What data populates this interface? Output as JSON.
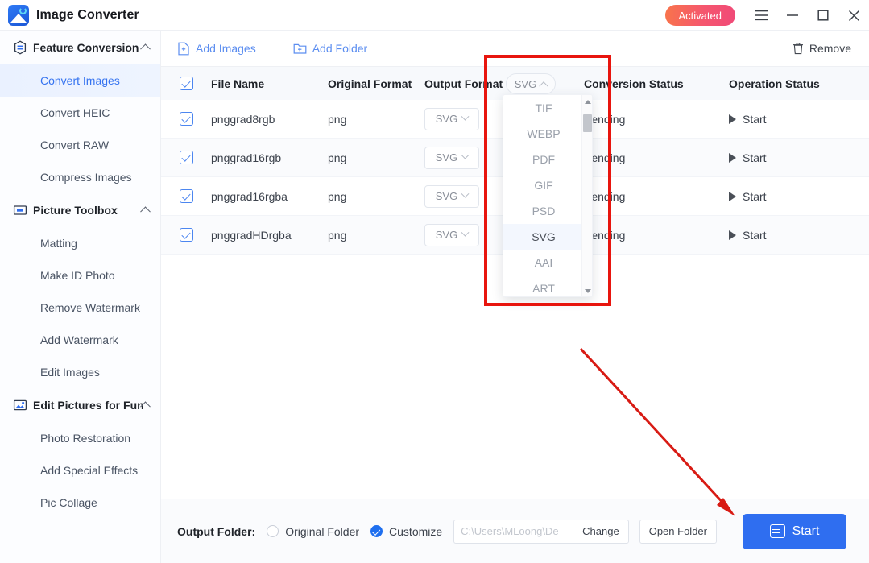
{
  "titlebar": {
    "app_title": "Image Converter",
    "activated_label": "Activated",
    "logo_icon": "image-refresh-logo-icon",
    "menu_icon": "hamburger-menu-icon",
    "minimize_icon": "minimize-icon",
    "maximize_icon": "maximize-icon",
    "close_icon": "close-icon",
    "accent": "#2f6ef0",
    "activated_gradient": [
      "#f8744b",
      "#f04a78"
    ]
  },
  "sidebar": {
    "sections": [
      {
        "label": "Feature Conversion",
        "icon": "conversion-hex-icon",
        "expanded": true,
        "items": [
          {
            "label": "Convert Images",
            "active": true
          },
          {
            "label": "Convert HEIC",
            "active": false
          },
          {
            "label": "Convert RAW",
            "active": false
          },
          {
            "label": "Compress Images",
            "active": false
          }
        ]
      },
      {
        "label": "Picture Toolbox",
        "icon": "toolbox-frame-icon",
        "expanded": true,
        "items": [
          {
            "label": "Matting",
            "active": false
          },
          {
            "label": "Make ID Photo",
            "active": false
          },
          {
            "label": "Remove Watermark",
            "active": false
          },
          {
            "label": "Add Watermark",
            "active": false
          },
          {
            "label": "Edit Images",
            "active": false
          }
        ]
      },
      {
        "label": "Edit Pictures for Fun",
        "icon": "picture-sparkle-icon",
        "expanded": true,
        "items": [
          {
            "label": "Photo Restoration",
            "active": false
          },
          {
            "label": "Add Special Effects",
            "active": false
          },
          {
            "label": "Pic Collage",
            "active": false
          }
        ]
      }
    ]
  },
  "toolbar": {
    "add_images_label": "Add Images",
    "add_folder_label": "Add Folder",
    "remove_label": "Remove",
    "add_images_icon": "file-plus-icon",
    "add_folder_icon": "folder-plus-icon",
    "remove_icon": "trash-icon"
  },
  "table": {
    "headers": {
      "file_name": "File Name",
      "original_format": "Original Format",
      "output_format": "Output Format",
      "conversion_status": "Conversion Status",
      "operation_status": "Operation Status"
    },
    "header_checkbox_checked": true,
    "rows": [
      {
        "checked": true,
        "file_name": "pnggrad8rgb",
        "original_format": "png",
        "output_format": "SVG",
        "conversion_status": "Pending",
        "operation": "Start"
      },
      {
        "checked": true,
        "file_name": "pnggrad16rgb",
        "original_format": "png",
        "output_format": "SVG",
        "conversion_status": "Pending",
        "operation": "Start"
      },
      {
        "checked": true,
        "file_name": "pnggrad16rgba",
        "original_format": "png",
        "output_format": "SVG",
        "conversion_status": "Pending",
        "operation": "Start"
      },
      {
        "checked": true,
        "file_name": "pnggradHDrgba",
        "original_format": "png",
        "output_format": "SVG",
        "conversion_status": "Pending",
        "operation": "Start"
      }
    ]
  },
  "format_dropdown": {
    "selected": "SVG",
    "open": true,
    "toggle_icon": "chevron-up-icon",
    "options": [
      "TIF",
      "WEBP",
      "PDF",
      "GIF",
      "PSD",
      "SVG",
      "AAI",
      "ART"
    ],
    "scrollbar": {
      "up_icon": "scroll-up-arrow-icon",
      "down_icon": "scroll-down-arrow-icon"
    }
  },
  "annotations": {
    "highlight_box_color": "#e8150e",
    "arrow_color": "#d81b14"
  },
  "bottom_bar": {
    "output_folder_label": "Output Folder:",
    "original_folder_label": "Original Folder",
    "original_folder_selected": false,
    "customize_label": "Customize",
    "customize_selected": true,
    "path_value": "C:\\Users\\MLoong\\De",
    "change_label": "Change",
    "open_folder_label": "Open Folder",
    "start_label": "Start",
    "start_icon": "convert-swap-icon"
  }
}
